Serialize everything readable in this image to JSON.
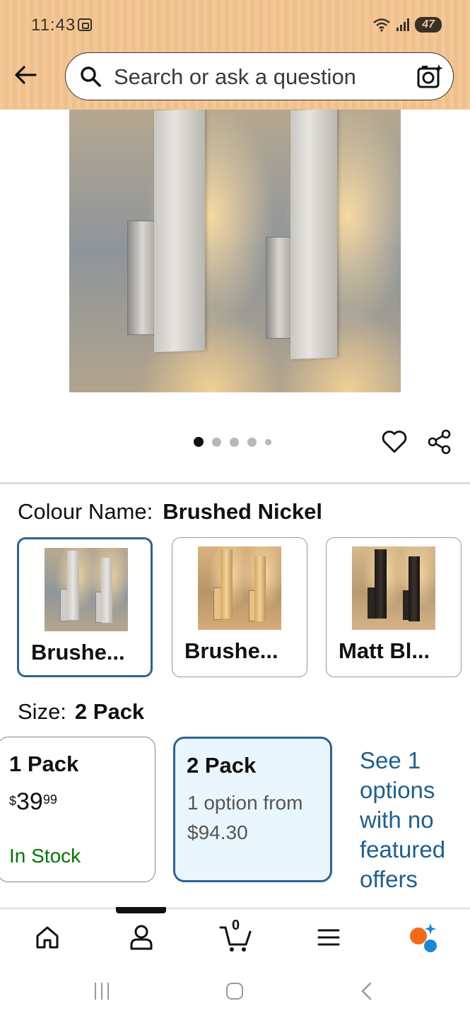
{
  "status_bar": {
    "time": "11:43",
    "battery": "47"
  },
  "search": {
    "placeholder": "Search or ask a question"
  },
  "carousel": {
    "total": 5,
    "active_index": 0
  },
  "colour": {
    "label": "Colour Name:",
    "selected": "Brushed Nickel",
    "options": [
      {
        "label": "Brushe...",
        "selected": true
      },
      {
        "label": "Brushe...",
        "selected": false
      },
      {
        "label": "Matt Bl...",
        "selected": false
      }
    ]
  },
  "size": {
    "label": "Size:",
    "selected": "2 Pack",
    "options": [
      {
        "title": "1 Pack",
        "price_symbol": "$",
        "price_whole": "39",
        "price_fraction": "99",
        "stock": "In Stock"
      },
      {
        "title": "2 Pack",
        "sub_line1": "1 option from",
        "sub_line2": "$94.30"
      }
    ],
    "see_options": "See 1 options with no featured offers"
  },
  "nav": {
    "cart_count": "0"
  },
  "colors": {
    "accent": "#2f6293",
    "link": "#1f5f8f",
    "stock": "#007600",
    "header": "#f3c896"
  }
}
